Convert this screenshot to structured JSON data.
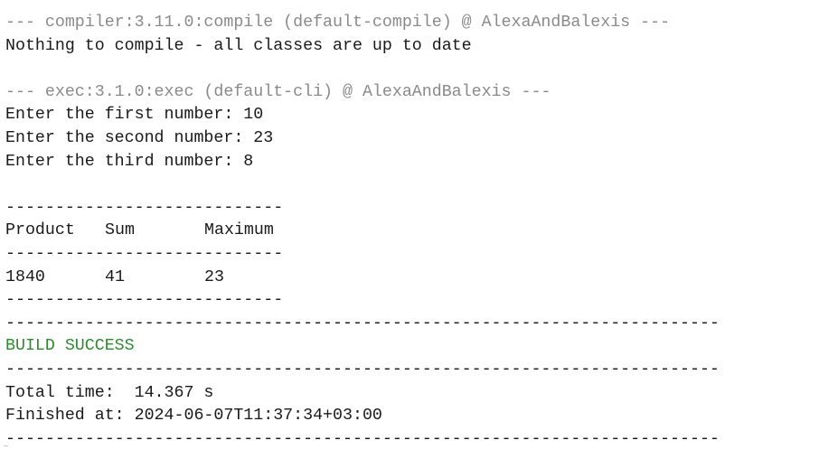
{
  "console": {
    "compile_header": "--- compiler:3.11.0:compile (default-compile) @ AlexaAndBalexis ---",
    "compile_msg": "Nothing to compile - all classes are up to date",
    "exec_header": "--- exec:3.1.0:exec (default-cli) @ AlexaAndBalexis ---",
    "prompt_first": "Enter the first number: 10",
    "prompt_second": "Enter the second number: 23",
    "prompt_third": "Enter the third number: 8",
    "table_rule": "----------------------------",
    "table_headers": [
      "Product",
      "Sum",
      "Maximum"
    ],
    "table_values": [
      "1840",
      "41",
      "23"
    ],
    "long_rule": "------------------------------------------------------------------------",
    "build_status": "BUILD SUCCESS",
    "total_time": "Total time:  14.367 s",
    "finished_at": "Finished at: 2024-06-07T11:37:34+03:00"
  },
  "colors": {
    "text": "#1a1a1a",
    "header_gray": "#8a8a8a",
    "success_green": "#2e8b2e",
    "background": "#ffffff"
  }
}
